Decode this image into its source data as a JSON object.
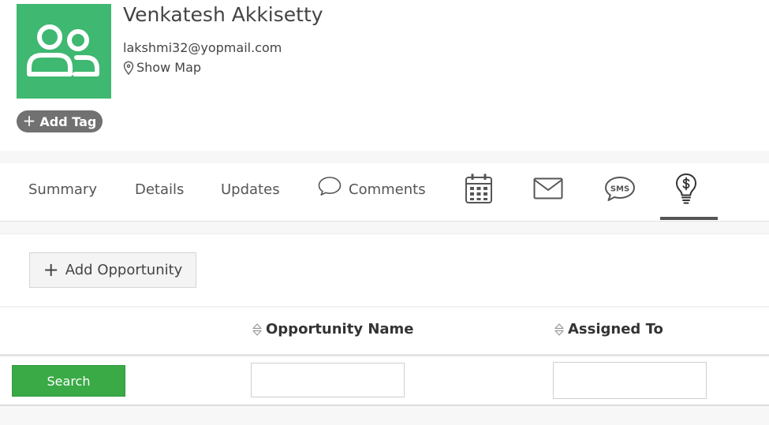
{
  "contact": {
    "name": "Venkatesh Akkisetty",
    "email": "lakshmi32@yopmail.com",
    "show_map_label": "Show Map",
    "add_tag_label": "Add Tag",
    "avatar_color": "#3fb871",
    "avatar_icon": "users-icon"
  },
  "tabs": {
    "summary": "Summary",
    "details": "Details",
    "updates": "Updates",
    "comments": "Comments",
    "calendar_icon": "calendar-icon",
    "email_icon": "envelope-icon",
    "sms_icon": "sms-icon",
    "sms_text": "SMS",
    "opportunities_icon": "lightbulb-dollar-icon",
    "active_tab": "opportunities"
  },
  "opportunities": {
    "add_button_label": "Add Opportunity",
    "columns": [
      "Opportunity Name",
      "Assigned To"
    ],
    "search_button_label": "Search",
    "filters": {
      "opportunity_name": "",
      "assigned_to": ""
    }
  },
  "colors": {
    "accent_green": "#3aaa46",
    "tag_gray": "#717171",
    "active_tab_underline": "#555555"
  }
}
